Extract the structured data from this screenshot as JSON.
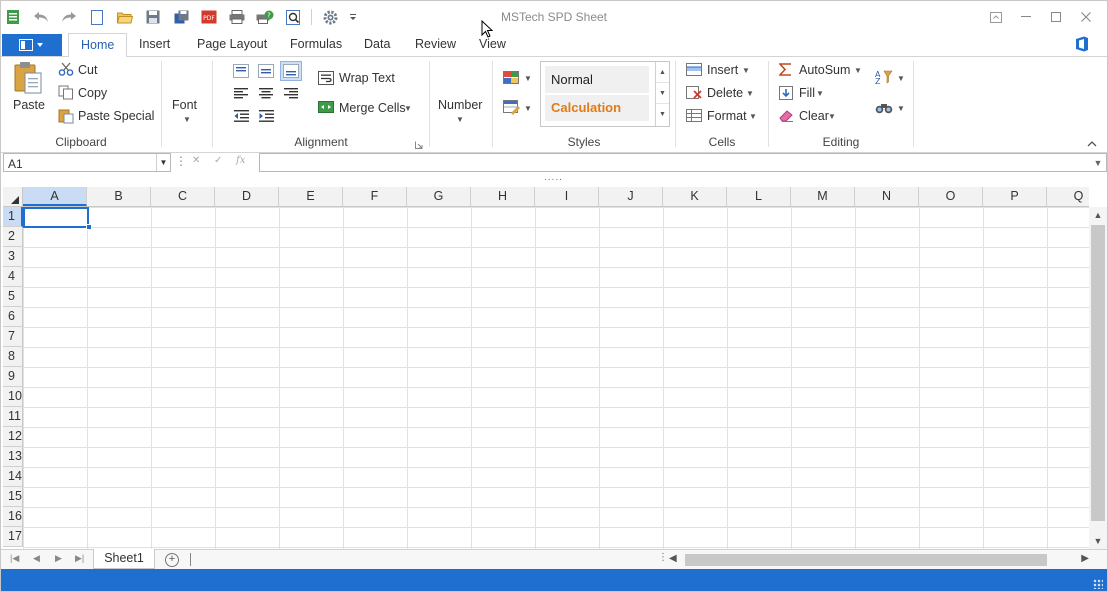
{
  "window": {
    "title": "MSTech SPD Sheet"
  },
  "ribbon_tabs": [
    "Home",
    "Insert",
    "Page Layout",
    "Formulas",
    "Data",
    "Review",
    "View"
  ],
  "active_tab": "Home",
  "clipboard": {
    "paste": "Paste",
    "cut": "Cut",
    "copy": "Copy",
    "paste_special": "Paste Special",
    "label": "Clipboard"
  },
  "font": {
    "label": "Font"
  },
  "alignment": {
    "wrap_text": "Wrap Text",
    "merge_cells": "Merge Cells",
    "label": "Alignment"
  },
  "number": {
    "label": "Number"
  },
  "styles": {
    "normal": "Normal",
    "calculation": "Calculation",
    "label": "Styles"
  },
  "cells_group": {
    "insert": "Insert",
    "delete": "Delete",
    "format": "Format",
    "label": "Cells"
  },
  "editing": {
    "autosum": "AutoSum",
    "fill": "Fill",
    "clear": "Clear",
    "label": "Editing"
  },
  "formula_bar": {
    "name_box": "A1",
    "formula": ""
  },
  "grid": {
    "columns": [
      "A",
      "B",
      "C",
      "D",
      "E",
      "F",
      "G",
      "H",
      "I",
      "J",
      "K",
      "L",
      "M",
      "N",
      "O",
      "P",
      "Q"
    ],
    "rows": [
      "1",
      "2",
      "3",
      "4",
      "5",
      "6",
      "7",
      "8",
      "9",
      "10",
      "11",
      "12",
      "13",
      "14",
      "15",
      "16",
      "17"
    ],
    "selected_cell": "A1"
  },
  "sheets": [
    "Sheet1"
  ],
  "colors": {
    "accent": "#1e6fd0",
    "calculation_text": "#e07b18"
  }
}
